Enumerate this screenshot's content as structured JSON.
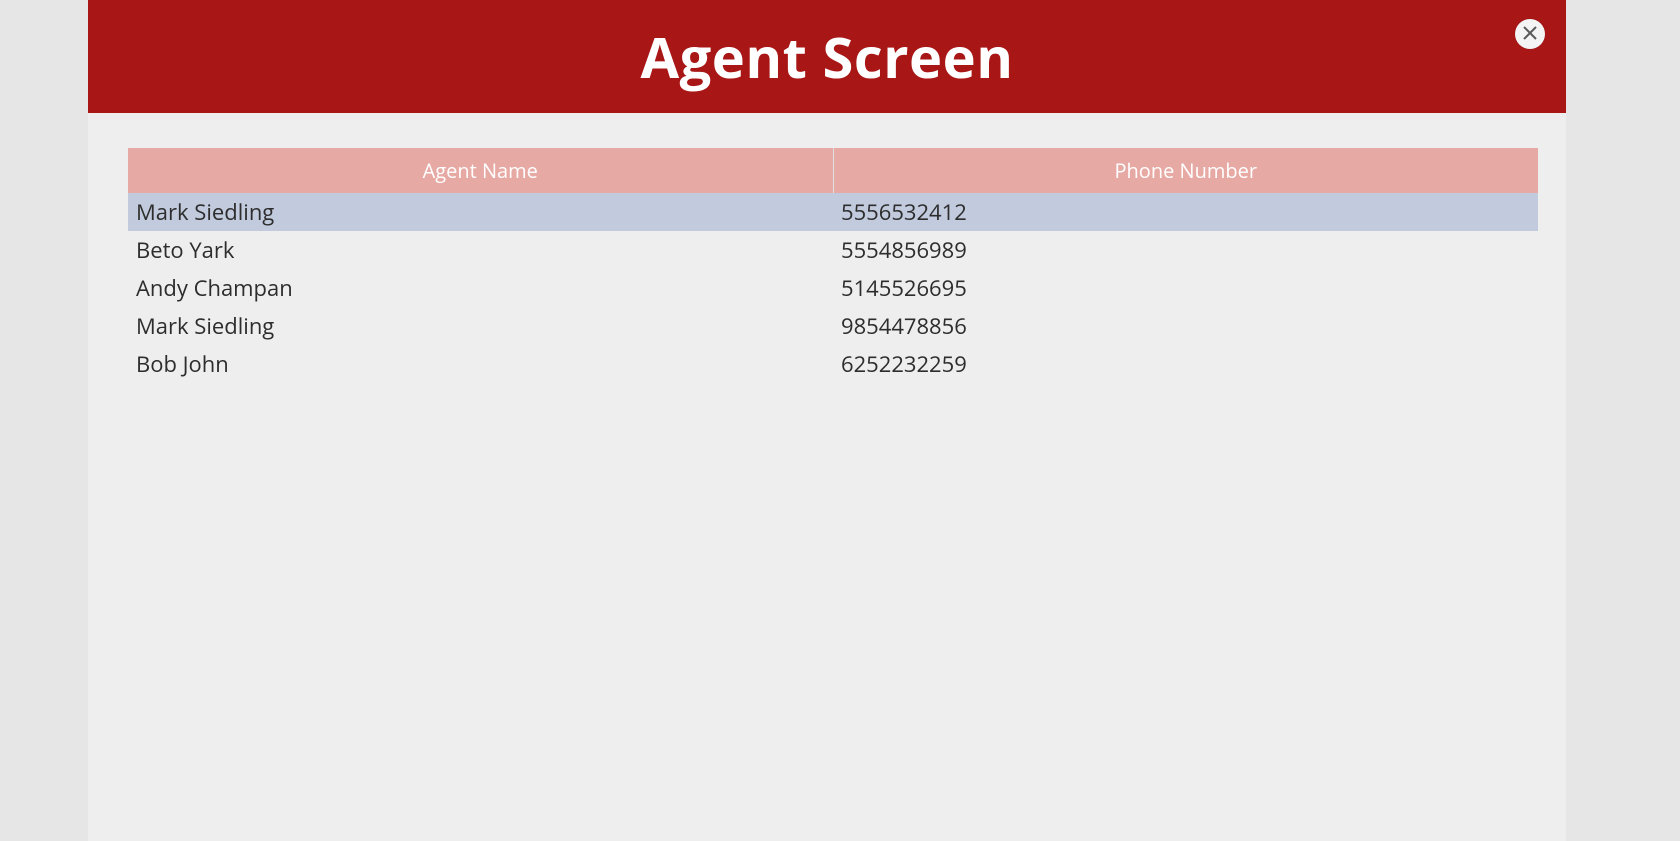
{
  "header": {
    "title": "Agent Screen"
  },
  "table": {
    "columns": [
      {
        "label": "Agent Name"
      },
      {
        "label": "Phone Number"
      }
    ],
    "rows": [
      {
        "name": "Mark Siedling",
        "phone": "5556532412",
        "selected": true
      },
      {
        "name": "Beto Yark",
        "phone": "5554856989",
        "selected": false
      },
      {
        "name": "Andy Champan",
        "phone": "5145526695",
        "selected": false
      },
      {
        "name": "Mark Siedling",
        "phone": "9854478856",
        "selected": false
      },
      {
        "name": "Bob John",
        "phone": "6252232259",
        "selected": false
      }
    ]
  },
  "close": {
    "label": "Close"
  }
}
